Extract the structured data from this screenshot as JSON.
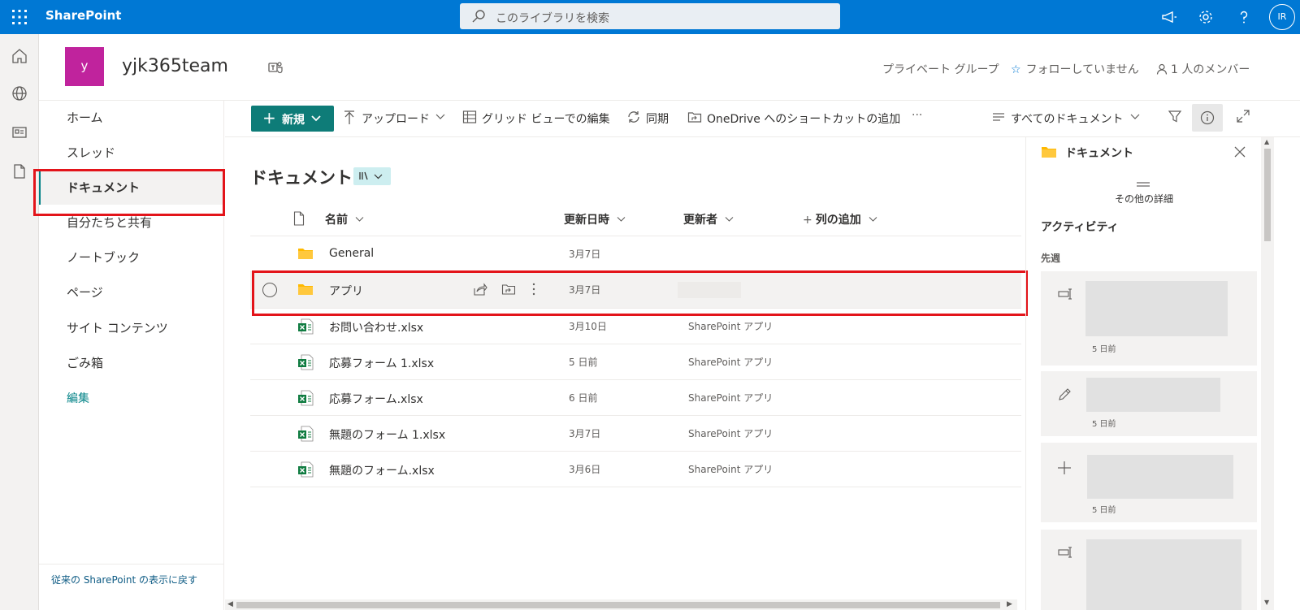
{
  "suite": {
    "app_name": "SharePoint",
    "search_placeholder": "このライブラリを検索",
    "user_initials": "IR"
  },
  "site": {
    "logo_letter": "y",
    "title": "yjk365team",
    "group_label": "プライベート グループ",
    "follow_label": "フォローしていません",
    "members_label": "1 人のメンバー",
    "logo_color": "#c0239d"
  },
  "nav": {
    "items": [
      {
        "label": "ホーム"
      },
      {
        "label": "スレッド"
      },
      {
        "label": "ドキュメント",
        "active": true
      },
      {
        "label": "自分たちと共有"
      },
      {
        "label": "ノートブック"
      },
      {
        "label": "ページ"
      },
      {
        "label": "サイト コンテンツ"
      },
      {
        "label": "ごみ箱"
      }
    ],
    "edit_label": "編集",
    "classic_link": "従来の SharePoint の表示に戻す"
  },
  "commands": {
    "new_label": "新規",
    "upload_label": "アップロード",
    "grid_edit_label": "グリッド ビューでの編集",
    "sync_label": "同期",
    "shortcut_label": "OneDrive へのショートカットの追加",
    "more_label": "···",
    "view_label": "すべてのドキュメント"
  },
  "library": {
    "title": "ドキュメント",
    "columns": {
      "name": "名前",
      "modified": "更新日時",
      "modified_by": "更新者",
      "add_column": "列の追加"
    },
    "rows": [
      {
        "name": "General",
        "type": "folder",
        "modified": "3月7日",
        "modified_by": ""
      },
      {
        "name": "アプリ",
        "type": "folder",
        "modified": "3月7日",
        "modified_by": "",
        "selected": true
      },
      {
        "name": "お問い合わせ.xlsx",
        "type": "excel",
        "modified": "3月10日",
        "modified_by": "SharePoint アプリ"
      },
      {
        "name": "応募フォーム 1.xlsx",
        "type": "excel",
        "modified": "5 日前",
        "modified_by": "SharePoint アプリ"
      },
      {
        "name": "応募フォーム.xlsx",
        "type": "excel",
        "modified": "6 日前",
        "modified_by": "SharePoint アプリ"
      },
      {
        "name": "無題のフォーム 1.xlsx",
        "type": "excel",
        "modified": "3月7日",
        "modified_by": "SharePoint アプリ"
      },
      {
        "name": "無題のフォーム.xlsx",
        "type": "excel",
        "modified": "3月6日",
        "modified_by": "SharePoint アプリ"
      }
    ]
  },
  "details_pane": {
    "title": "ドキュメント",
    "more_details": "その他の詳細",
    "activity_heading": "アクティビティ",
    "last_week": "先週",
    "activities": [
      {
        "icon": "rename-icon",
        "time": "5 日前"
      },
      {
        "icon": "pencil-icon",
        "time": "5 日前"
      },
      {
        "icon": "plus-icon",
        "time": "5 日前"
      },
      {
        "icon": "rename-icon",
        "time": ""
      }
    ]
  },
  "colors": {
    "suite_bar": "#0078d4",
    "accent": "#038387",
    "new_button": "#0e7c78",
    "highlight_box": "#e3141a"
  }
}
